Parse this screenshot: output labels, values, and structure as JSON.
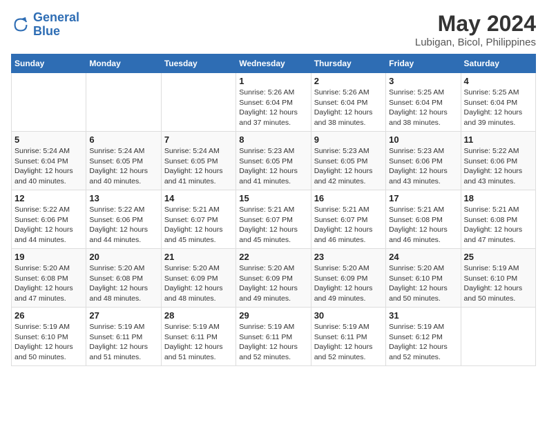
{
  "header": {
    "logo_line1": "General",
    "logo_line2": "Blue",
    "title": "May 2024",
    "subtitle": "Lubigan, Bicol, Philippines"
  },
  "weekdays": [
    "Sunday",
    "Monday",
    "Tuesday",
    "Wednesday",
    "Thursday",
    "Friday",
    "Saturday"
  ],
  "weeks": [
    [
      {
        "day": "",
        "info": ""
      },
      {
        "day": "",
        "info": ""
      },
      {
        "day": "",
        "info": ""
      },
      {
        "day": "1",
        "info": "Sunrise: 5:26 AM\nSunset: 6:04 PM\nDaylight: 12 hours and 37 minutes."
      },
      {
        "day": "2",
        "info": "Sunrise: 5:26 AM\nSunset: 6:04 PM\nDaylight: 12 hours and 38 minutes."
      },
      {
        "day": "3",
        "info": "Sunrise: 5:25 AM\nSunset: 6:04 PM\nDaylight: 12 hours and 38 minutes."
      },
      {
        "day": "4",
        "info": "Sunrise: 5:25 AM\nSunset: 6:04 PM\nDaylight: 12 hours and 39 minutes."
      }
    ],
    [
      {
        "day": "5",
        "info": "Sunrise: 5:24 AM\nSunset: 6:04 PM\nDaylight: 12 hours and 40 minutes."
      },
      {
        "day": "6",
        "info": "Sunrise: 5:24 AM\nSunset: 6:05 PM\nDaylight: 12 hours and 40 minutes."
      },
      {
        "day": "7",
        "info": "Sunrise: 5:24 AM\nSunset: 6:05 PM\nDaylight: 12 hours and 41 minutes."
      },
      {
        "day": "8",
        "info": "Sunrise: 5:23 AM\nSunset: 6:05 PM\nDaylight: 12 hours and 41 minutes."
      },
      {
        "day": "9",
        "info": "Sunrise: 5:23 AM\nSunset: 6:05 PM\nDaylight: 12 hours and 42 minutes."
      },
      {
        "day": "10",
        "info": "Sunrise: 5:23 AM\nSunset: 6:06 PM\nDaylight: 12 hours and 43 minutes."
      },
      {
        "day": "11",
        "info": "Sunrise: 5:22 AM\nSunset: 6:06 PM\nDaylight: 12 hours and 43 minutes."
      }
    ],
    [
      {
        "day": "12",
        "info": "Sunrise: 5:22 AM\nSunset: 6:06 PM\nDaylight: 12 hours and 44 minutes."
      },
      {
        "day": "13",
        "info": "Sunrise: 5:22 AM\nSunset: 6:06 PM\nDaylight: 12 hours and 44 minutes."
      },
      {
        "day": "14",
        "info": "Sunrise: 5:21 AM\nSunset: 6:07 PM\nDaylight: 12 hours and 45 minutes."
      },
      {
        "day": "15",
        "info": "Sunrise: 5:21 AM\nSunset: 6:07 PM\nDaylight: 12 hours and 45 minutes."
      },
      {
        "day": "16",
        "info": "Sunrise: 5:21 AM\nSunset: 6:07 PM\nDaylight: 12 hours and 46 minutes."
      },
      {
        "day": "17",
        "info": "Sunrise: 5:21 AM\nSunset: 6:08 PM\nDaylight: 12 hours and 46 minutes."
      },
      {
        "day": "18",
        "info": "Sunrise: 5:21 AM\nSunset: 6:08 PM\nDaylight: 12 hours and 47 minutes."
      }
    ],
    [
      {
        "day": "19",
        "info": "Sunrise: 5:20 AM\nSunset: 6:08 PM\nDaylight: 12 hours and 47 minutes."
      },
      {
        "day": "20",
        "info": "Sunrise: 5:20 AM\nSunset: 6:08 PM\nDaylight: 12 hours and 48 minutes."
      },
      {
        "day": "21",
        "info": "Sunrise: 5:20 AM\nSunset: 6:09 PM\nDaylight: 12 hours and 48 minutes."
      },
      {
        "day": "22",
        "info": "Sunrise: 5:20 AM\nSunset: 6:09 PM\nDaylight: 12 hours and 49 minutes."
      },
      {
        "day": "23",
        "info": "Sunrise: 5:20 AM\nSunset: 6:09 PM\nDaylight: 12 hours and 49 minutes."
      },
      {
        "day": "24",
        "info": "Sunrise: 5:20 AM\nSunset: 6:10 PM\nDaylight: 12 hours and 50 minutes."
      },
      {
        "day": "25",
        "info": "Sunrise: 5:19 AM\nSunset: 6:10 PM\nDaylight: 12 hours and 50 minutes."
      }
    ],
    [
      {
        "day": "26",
        "info": "Sunrise: 5:19 AM\nSunset: 6:10 PM\nDaylight: 12 hours and 50 minutes."
      },
      {
        "day": "27",
        "info": "Sunrise: 5:19 AM\nSunset: 6:11 PM\nDaylight: 12 hours and 51 minutes."
      },
      {
        "day": "28",
        "info": "Sunrise: 5:19 AM\nSunset: 6:11 PM\nDaylight: 12 hours and 51 minutes."
      },
      {
        "day": "29",
        "info": "Sunrise: 5:19 AM\nSunset: 6:11 PM\nDaylight: 12 hours and 52 minutes."
      },
      {
        "day": "30",
        "info": "Sunrise: 5:19 AM\nSunset: 6:11 PM\nDaylight: 12 hours and 52 minutes."
      },
      {
        "day": "31",
        "info": "Sunrise: 5:19 AM\nSunset: 6:12 PM\nDaylight: 12 hours and 52 minutes."
      },
      {
        "day": "",
        "info": ""
      }
    ]
  ]
}
